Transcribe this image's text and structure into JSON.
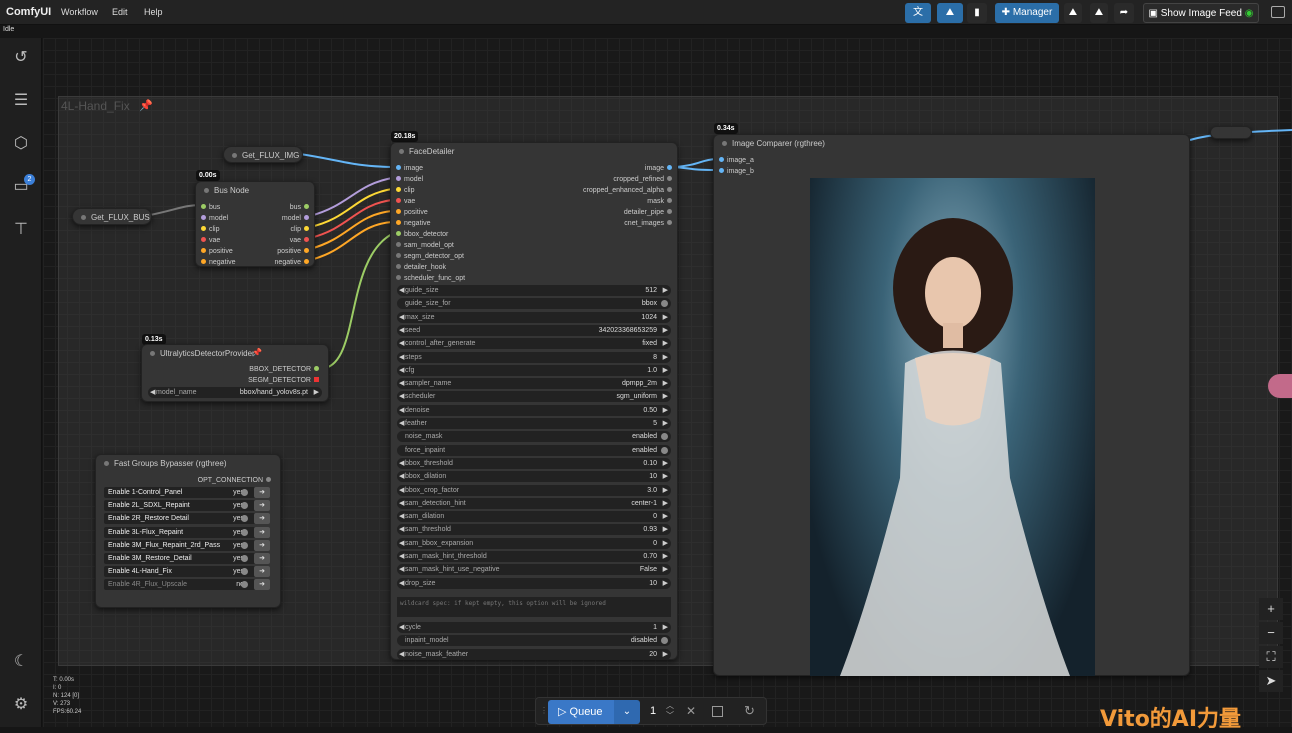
{
  "app": {
    "title": "ComfyUI",
    "status": "Idle",
    "menu": [
      "Workflow",
      "Edit",
      "Help"
    ]
  },
  "toolbar": {
    "manager": "Manager",
    "image_feed": "Show Image Feed"
  },
  "stats": [
    "T: 0.00s",
    "I: 0",
    "N: 124 [0]",
    "V: 273",
    "FPS:60.24"
  ],
  "sidebar": {
    "queue_badge": "2"
  },
  "group": {
    "title": "4L-Hand_Fix"
  },
  "nodes": {
    "get_img": {
      "title": "Get_FLUX_IMG"
    },
    "get_bus": {
      "title": "Get_FLUX_BUS"
    },
    "bus_node": {
      "title": "Bus Node",
      "time": "0.00s",
      "inputs": [
        "bus",
        "model",
        "clip",
        "vae",
        "positive",
        "negative"
      ],
      "outputs": [
        "bus",
        "model",
        "clip",
        "vae",
        "positive",
        "negative"
      ]
    },
    "ultra": {
      "title": "UltralyticsDetectorProvider",
      "time": "0.13s",
      "outputs": [
        "BBOX_DETECTOR",
        "SEGM_DETECTOR"
      ],
      "widget_label": "model_name",
      "widget_value": "bbox/hand_yolov8s.pt"
    },
    "face": {
      "title": "FaceDetailer",
      "time": "20.18s",
      "inputs": [
        "image",
        "model",
        "clip",
        "vae",
        "positive",
        "negative",
        "bbox_detector",
        "sam_model_opt",
        "segm_detector_opt",
        "detailer_hook",
        "scheduler_func_opt"
      ],
      "outputs": [
        "image",
        "cropped_refined",
        "cropped_enhanced_alpha",
        "mask",
        "detailer_pipe",
        "cnet_images"
      ],
      "widgets": [
        [
          "guide_size",
          "512"
        ],
        [
          "guide_size_for",
          "bbox"
        ],
        [
          "max_size",
          "1024"
        ],
        [
          "seed",
          "342023368653259"
        ],
        [
          "control_after_generate",
          "fixed"
        ],
        [
          "steps",
          "8"
        ],
        [
          "cfg",
          "1.0"
        ],
        [
          "sampler_name",
          "dpmpp_2m"
        ],
        [
          "scheduler",
          "sgm_uniform"
        ],
        [
          "denoise",
          "0.50"
        ],
        [
          "feather",
          "5"
        ],
        [
          "noise_mask",
          "enabled"
        ],
        [
          "force_inpaint",
          "enabled"
        ],
        [
          "bbox_threshold",
          "0.10"
        ],
        [
          "bbox_dilation",
          "10"
        ],
        [
          "bbox_crop_factor",
          "3.0"
        ],
        [
          "sam_detection_hint",
          "center-1"
        ],
        [
          "sam_dilation",
          "0"
        ],
        [
          "sam_threshold",
          "0.93"
        ],
        [
          "sam_bbox_expansion",
          "0"
        ],
        [
          "sam_mask_hint_threshold",
          "0.70"
        ],
        [
          "sam_mask_hint_use_negative",
          "False"
        ],
        [
          "drop_size",
          "10"
        ]
      ],
      "wildcard": "wildcard spec: if kept empty, this option will be ignored",
      "widgets2": [
        [
          "cycle",
          "1"
        ],
        [
          "inpaint_model",
          "disabled"
        ],
        [
          "noise_mask_feather",
          "20"
        ]
      ]
    },
    "comparer": {
      "title": "Image Comparer (rgthree)",
      "time": "0.34s",
      "inputs": [
        "image_a",
        "image_b"
      ]
    },
    "bypasser": {
      "title": "Fast Groups Bypasser (rgthree)",
      "output": "OPT_CONNECTION",
      "rows": [
        [
          "Enable 1-Control_Panel",
          "yes"
        ],
        [
          "Enable 2L_SDXL_Repaint",
          "yes"
        ],
        [
          "Enable 2R_Restore Detail",
          "yes"
        ],
        [
          "Enable 3L-Flux_Repaint",
          "yes"
        ],
        [
          "Enable 3M_Flux_Repaint_2rd_Pass",
          "yes"
        ],
        [
          "Enable 3M_Restore_Detail",
          "yes"
        ],
        [
          "Enable 4L-Hand_Fix",
          "yes"
        ],
        [
          "Enable 4R_Flux_Upscale",
          "no"
        ]
      ]
    }
  },
  "queue": {
    "label": "Queue",
    "count": "1"
  },
  "watermark": "Vito的AI力量",
  "colors": {
    "accent": "#2b6ea8",
    "bg": "#191919",
    "node": "#353535"
  }
}
